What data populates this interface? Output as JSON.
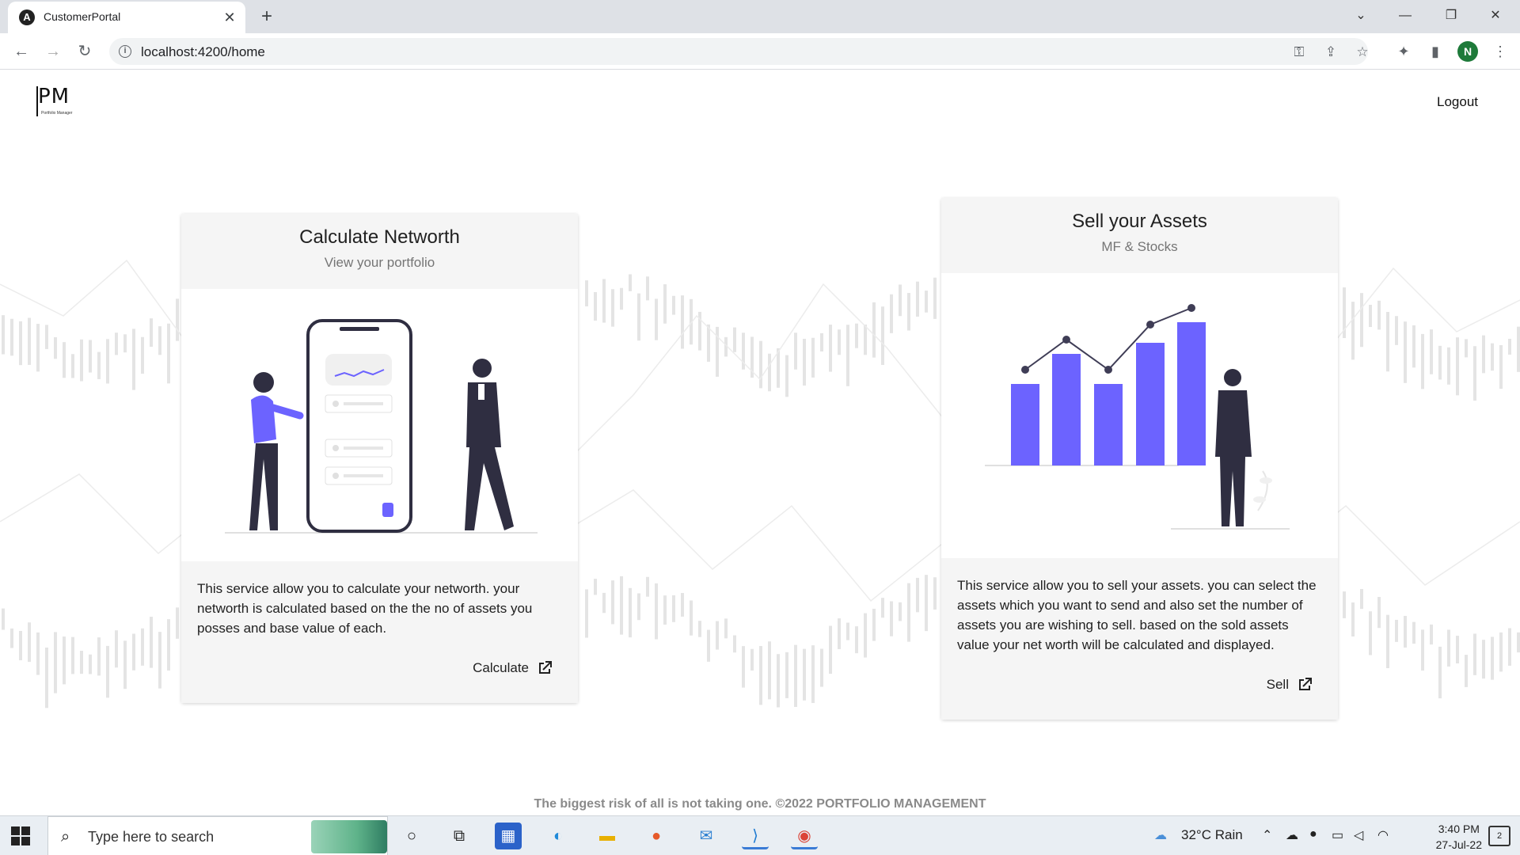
{
  "browser": {
    "tab_title": "CustomerPortal",
    "url": "localhost:4200/home",
    "profile_initial": "N"
  },
  "header": {
    "logo_text": "PM",
    "logo_subtext": "Portfolio Manager",
    "logout_label": "Logout"
  },
  "cards": [
    {
      "title": "Calculate Networth",
      "subtitle": "View your portfolio",
      "description": "This service allow you to calculate your networth. your networth is calculated based on the the no of assets you posses and base value of each.",
      "action_label": "Calculate"
    },
    {
      "title": "Sell your Assets",
      "subtitle": "MF & Stocks",
      "description": "This service allow you to sell your assets. you can select the assets which you want to send and also set the number of assets you are wishing to sell. based on the sold assets value your net worth will be calculated and displayed.",
      "action_label": "Sell"
    }
  ],
  "footer": {
    "text": "The biggest risk of all is not taking one. ©2022 PORTFOLIO MANAGEMENT"
  },
  "taskbar": {
    "search_placeholder": "Type here to search",
    "weather": "32°C  Rain",
    "time": "3:40 PM",
    "date": "27-Jul-22",
    "notification_count": "2"
  },
  "colors": {
    "accent": "#6c63ff",
    "figure_dark": "#2f2e41",
    "card_bg": "#f5f5f5"
  }
}
